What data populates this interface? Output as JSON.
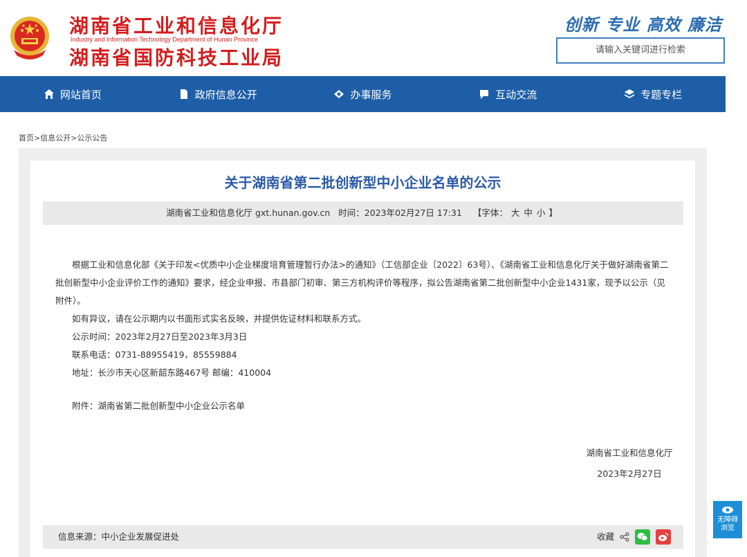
{
  "header": {
    "dept_cn_1": "湖南省工业和信息化厅",
    "dept_en": "Industry and Information Technology Department of Hunan Province",
    "dept_cn_2": "湖南省国防科技工业局",
    "slogan": "创新 专业 高效 廉洁",
    "search_placeholder": "请输入关键词进行检索",
    "emblem_icon": "national-emblem-icon"
  },
  "nav": [
    {
      "label": "网站首页",
      "icon": "home-icon"
    },
    {
      "label": "政府信息公开",
      "icon": "document-icon"
    },
    {
      "label": "办事服务",
      "icon": "handshake-icon"
    },
    {
      "label": "互动交流",
      "icon": "chat-icon"
    },
    {
      "label": "专题专栏",
      "icon": "layers-icon"
    }
  ],
  "breadcrumb": "首页>信息公开>公示公告",
  "article": {
    "title": "关于湖南省第二批创新型中小企业名单的公示",
    "source_site": "湖南省工业和信息化厅 gxt.hunan.gov.cn",
    "time": "时间：2023年02月27日 17:31",
    "font_label": "【字体：",
    "font_large": "大",
    "font_medium": "中",
    "font_small": "小",
    "font_end": "】",
    "paragraphs": [
      "根据工业和信息化部《关于印发<优质中小企业梯度培育管理暂行办法>的通知》（工信部企业〔2022〕63号）、《湖南省工业和信息化厅关于做好湖南省第二批创新型中小企业评价工作的通知》要求，经企业申报、市县部门初审、第三方机构评价等程序，拟公告湖南省第二批创新型中小企业1431家，现予以公示（见附件）。",
      "如有异议，请在公示期内以书面形式实名反映，并提供佐证材料和联系方式。",
      "公示时间：2023年2月27日至2023年3月3日",
      "联系电话：0731-88955419，85559884",
      "地址：长沙市天心区新韶东路467号 邮编：410004"
    ],
    "attachment": "附件：湖南省第二批创新型中小企业公示名单",
    "signature_org": "湖南省工业和信息化厅",
    "signature_date": "2023年2月27日"
  },
  "footer": {
    "source": "信息来源：中小企业发展促进处",
    "favorite": "收藏"
  },
  "accessibility": {
    "line1": "无障碍",
    "line2": "浏览"
  }
}
